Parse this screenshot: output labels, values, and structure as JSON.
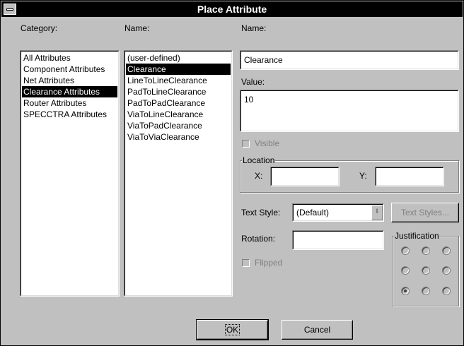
{
  "window": {
    "title": "Place Attribute"
  },
  "category": {
    "label": "Category:",
    "items": [
      "All Attributes",
      "Component Attributes",
      "Net Attributes",
      "Clearance Attributes",
      "Router Attributes",
      "SPECCTRA Attributes"
    ],
    "selected": "Clearance Attributes"
  },
  "names": {
    "label": "Name:",
    "items": [
      "(user-defined)",
      "Clearance",
      "LineToLineClearance",
      "PadToLineClearance",
      "PadToPadClearance",
      "ViaToLineClearance",
      "ViaToPadClearance",
      "ViaToViaClearance"
    ],
    "selected": "Clearance"
  },
  "name_field": {
    "label": "Name:",
    "value": "Clearance"
  },
  "value_field": {
    "label": "Value:",
    "value": "10"
  },
  "visible": {
    "label": "Visible",
    "checked": false
  },
  "location": {
    "legend": "Location",
    "x_label": "X:",
    "y_label": "Y:",
    "x_value": "",
    "y_value": ""
  },
  "text_style": {
    "label": "Text Style:",
    "value": "(Default)",
    "button": "Text Styles..."
  },
  "rotation": {
    "label": "Rotation:",
    "value": ""
  },
  "flipped": {
    "label": "Flipped",
    "checked": false
  },
  "justification": {
    "legend": "Justification",
    "selected": "bottom-left"
  },
  "buttons": {
    "ok": "OK",
    "cancel": "Cancel"
  },
  "colors": {
    "titlebar": "#000000",
    "dialog": "#c0c0c0",
    "selection": "#000000"
  }
}
